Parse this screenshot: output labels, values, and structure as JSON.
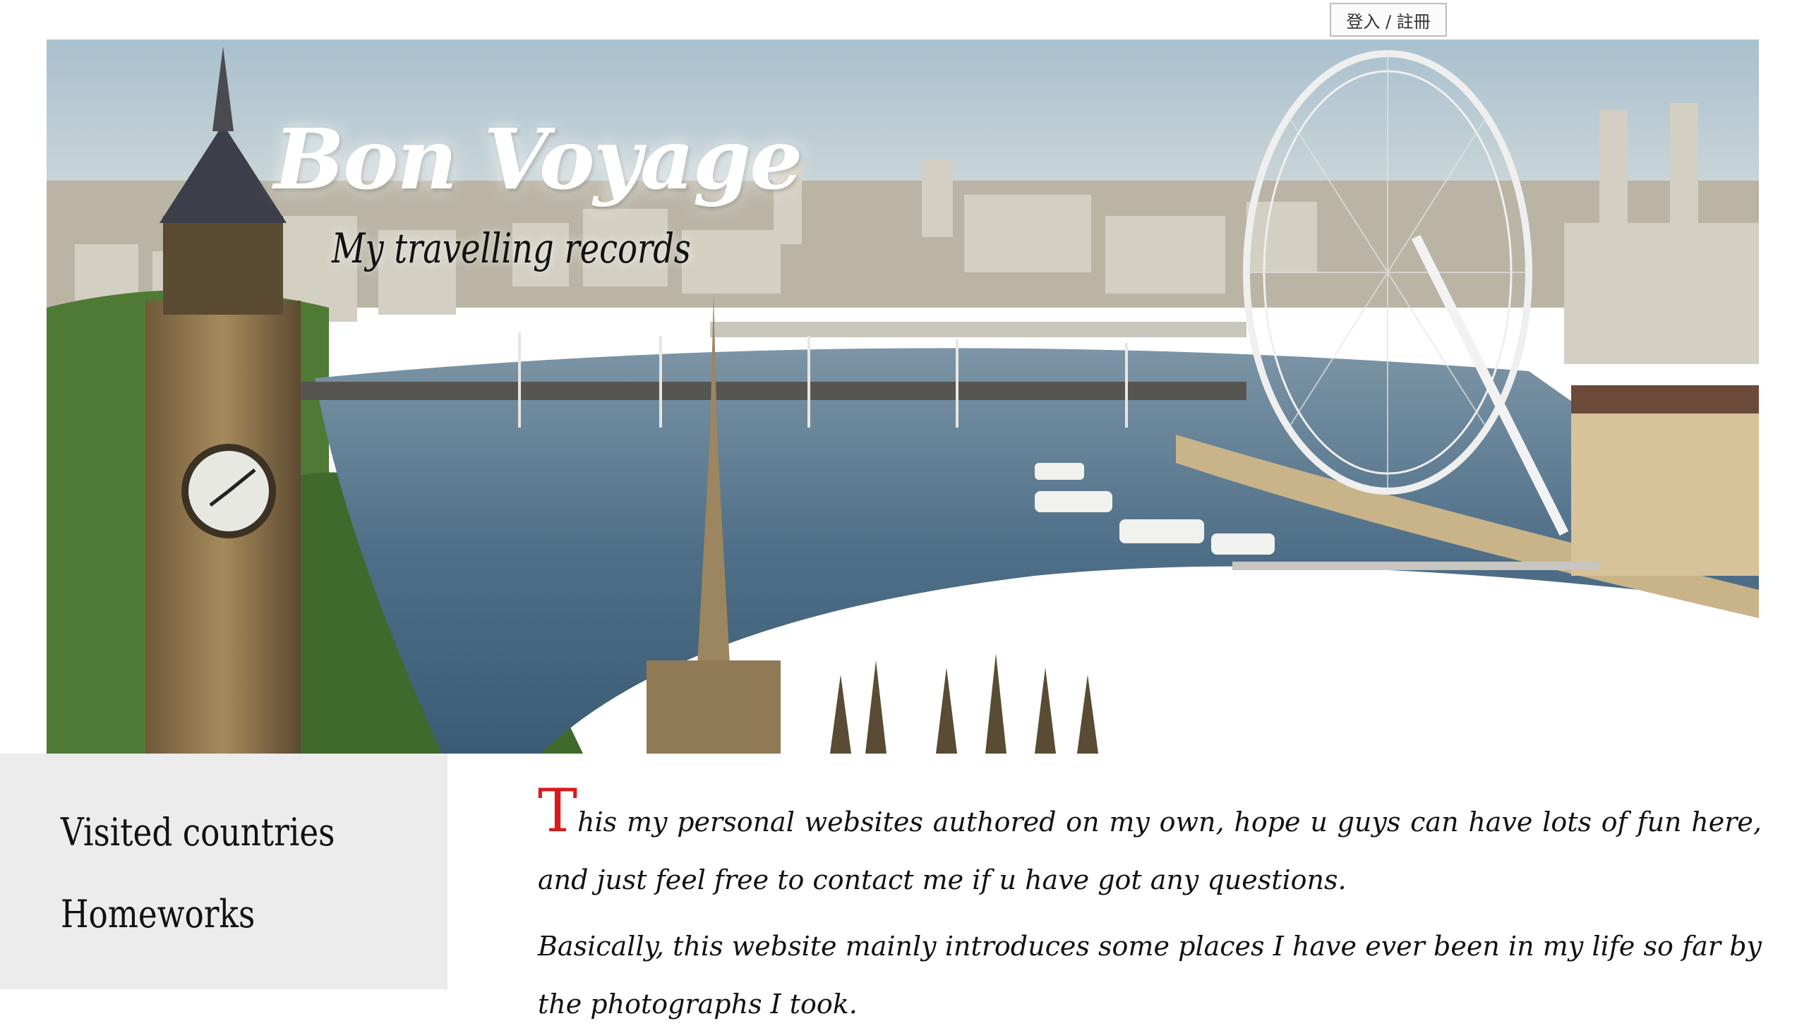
{
  "header": {
    "login_label": "登入 / 註冊"
  },
  "hero": {
    "title": "Bon Voyage",
    "subtitle": "My travelling records",
    "image_alt": "London skyline with Big Ben, Thames river, bridges and the London Eye"
  },
  "sidebar": {
    "items": [
      {
        "label": "Visited countries"
      },
      {
        "label": "Homeworks"
      }
    ]
  },
  "content": {
    "dropcap": "T",
    "paragraph1_rest": "his my personal websites authored on my own, hope u guys can have lots of fun here, and just feel free to contact me if u have got any questions.",
    "paragraph2": "Basically, this website mainly introduces some places I have ever been in my life so far by the photographs I took."
  },
  "colors": {
    "dropcap": "#d91a1a",
    "sidebar_bg": "#ececec",
    "title": "#ffffff"
  }
}
